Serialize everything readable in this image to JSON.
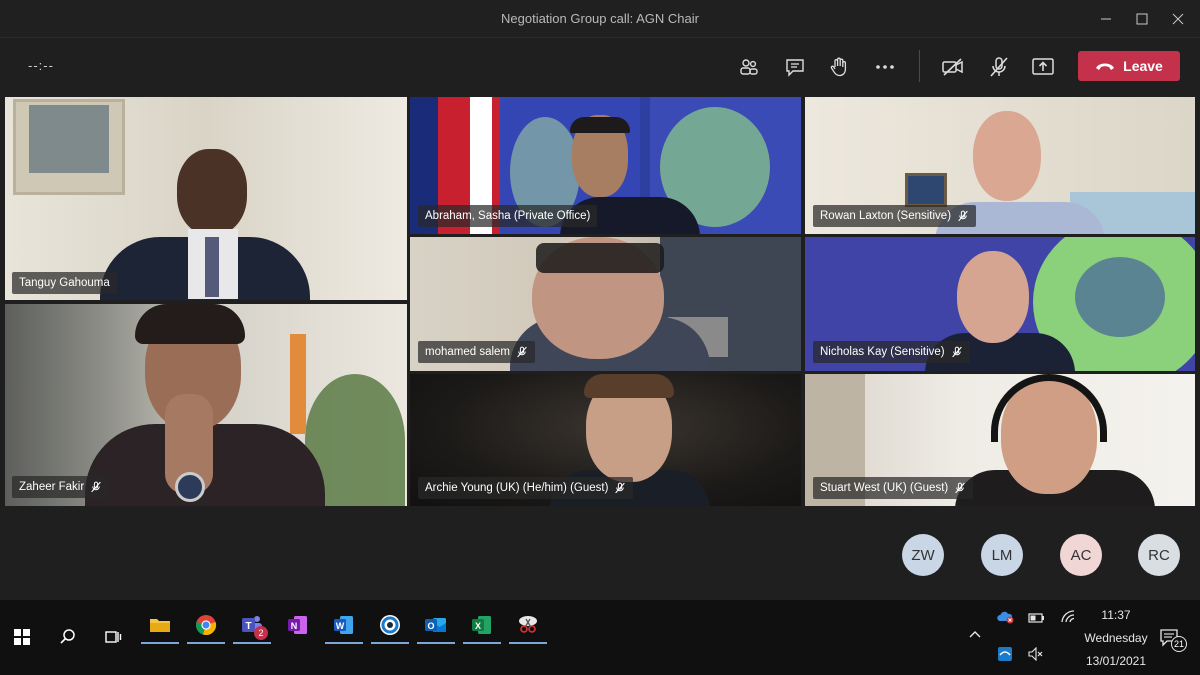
{
  "window": {
    "title": "Negotiation Group call: AGN Chair"
  },
  "toolbar": {
    "timer": "--:--",
    "leave_label": "Leave",
    "icons": [
      "participants-icon",
      "chat-icon",
      "raise-hand-icon",
      "more-options-icon",
      "camera-off-icon",
      "mic-off-icon",
      "share-screen-icon"
    ]
  },
  "participants": [
    {
      "name": "Tanguy Gahouma",
      "muted": false
    },
    {
      "name": "Abraham, Sasha (Private Office)",
      "muted": false
    },
    {
      "name": "Rowan Laxton (Sensitive)",
      "muted": true
    },
    {
      "name": "mohamed salem",
      "muted": true
    },
    {
      "name": "Nicholas Kay (Sensitive)",
      "muted": true
    },
    {
      "name": "Zaheer Fakir",
      "muted": true
    },
    {
      "name": "Archie Young (UK) (He/him) (Guest)",
      "muted": true
    },
    {
      "name": "Stuart West (UK) (Guest)",
      "muted": true
    }
  ],
  "avatars": [
    {
      "initials": "ZW",
      "color": "#c9d6e6"
    },
    {
      "initials": "LM",
      "color": "#c9d6e6"
    },
    {
      "initials": "AC",
      "color": "#f1d6d6"
    },
    {
      "initials": "RC",
      "color": "#d9dee3"
    }
  ],
  "taskbar": {
    "apps": [
      "file-explorer-icon",
      "chrome-icon",
      "teams-icon",
      "onenote-icon",
      "word-icon",
      "webex-icon",
      "outlook-icon",
      "excel-icon",
      "snipping-tool-icon"
    ],
    "teams_badge": "2",
    "clock_time": "11:37",
    "clock_day": "Wednesday",
    "clock_date": "13/01/2021",
    "notification_count": "21"
  },
  "colors": {
    "leave": "#c4314b",
    "background": "#1f1f1f",
    "taskbar": "#101010"
  }
}
